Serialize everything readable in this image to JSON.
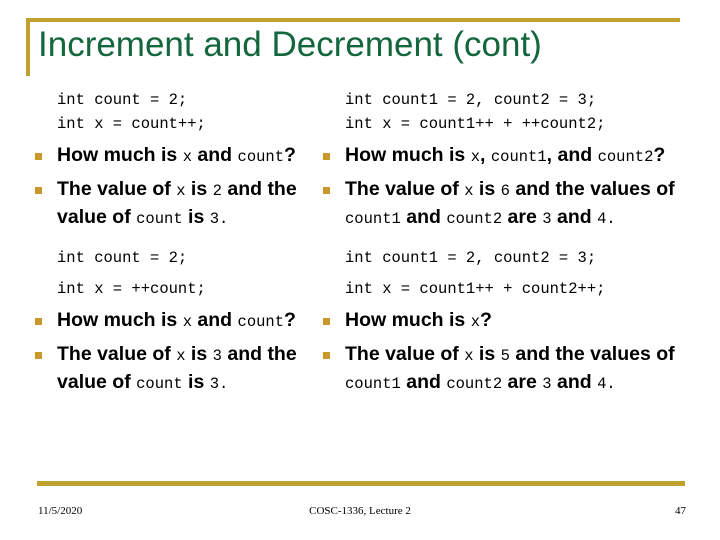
{
  "slide": {
    "title": "Increment and Decrement (cont)",
    "accent_gold": "#BFA22E",
    "bullet_gold": "#C8982A",
    "title_green": "#14663C"
  },
  "left_column": {
    "block1": {
      "code": [
        "int count = 2;",
        "int x = count++;"
      ],
      "bullets": [
        {
          "parts": [
            {
              "text": "How much is ",
              "style": "bold"
            },
            {
              "text": "x",
              "style": "mono"
            },
            {
              "text": " and ",
              "style": "bold"
            },
            {
              "text": "count",
              "style": "mono"
            },
            {
              "text": "?",
              "style": "bold"
            }
          ]
        },
        {
          "parts": [
            {
              "text": "The value of ",
              "style": "bold"
            },
            {
              "text": "x",
              "style": "mono"
            },
            {
              "text": " is ",
              "style": "bold"
            },
            {
              "text": "2",
              "style": "mono"
            },
            {
              "text": " and the value of ",
              "style": "bold"
            },
            {
              "text": "count",
              "style": "mono"
            },
            {
              "text": " is ",
              "style": "bold"
            },
            {
              "text": "3.",
              "style": "mono"
            }
          ]
        }
      ]
    },
    "block2": {
      "code": [
        "int count = 2;",
        "int x = ++count;"
      ],
      "bullets": [
        {
          "parts": [
            {
              "text": "How much is ",
              "style": "bold"
            },
            {
              "text": "x",
              "style": "mono"
            },
            {
              "text": " and ",
              "style": "bold"
            },
            {
              "text": "count",
              "style": "mono"
            },
            {
              "text": "?",
              "style": "bold"
            }
          ]
        },
        {
          "parts": [
            {
              "text": "The value of ",
              "style": "bold"
            },
            {
              "text": "x",
              "style": "mono"
            },
            {
              "text": " is ",
              "style": "bold"
            },
            {
              "text": "3",
              "style": "mono"
            },
            {
              "text": " and the value of ",
              "style": "bold"
            },
            {
              "text": "count",
              "style": "mono"
            },
            {
              "text": " is ",
              "style": "bold"
            },
            {
              "text": "3.",
              "style": "mono"
            }
          ]
        }
      ]
    }
  },
  "right_column": {
    "block1": {
      "code": [
        "int count1 = 2, count2 = 3;",
        "int x = count1++ + ++count2;"
      ],
      "bullets": [
        {
          "parts": [
            {
              "text": "How much is ",
              "style": "bold"
            },
            {
              "text": "x",
              "style": "mono"
            },
            {
              "text": ", ",
              "style": "bold"
            },
            {
              "text": "count1",
              "style": "mono"
            },
            {
              "text": ", and ",
              "style": "bold"
            },
            {
              "text": "count2",
              "style": "mono"
            },
            {
              "text": "?",
              "style": "bold"
            }
          ]
        },
        {
          "parts": [
            {
              "text": "The value of ",
              "style": "bold"
            },
            {
              "text": "x",
              "style": "mono"
            },
            {
              "text": " is ",
              "style": "bold"
            },
            {
              "text": "6",
              "style": "mono"
            },
            {
              "text": " and the values of ",
              "style": "bold"
            },
            {
              "text": "count1",
              "style": "mono"
            },
            {
              "text": " and ",
              "style": "bold"
            },
            {
              "text": "count2",
              "style": "mono"
            },
            {
              "text": " are ",
              "style": "bold"
            },
            {
              "text": "3",
              "style": "mono"
            },
            {
              "text": " and ",
              "style": "bold"
            },
            {
              "text": "4.",
              "style": "mono"
            }
          ]
        }
      ]
    },
    "block2": {
      "code": [
        "int count1 = 2, count2 = 3;",
        "int x = count1++ + count2++;"
      ],
      "bullets": [
        {
          "parts": [
            {
              "text": "How much is ",
              "style": "bold"
            },
            {
              "text": "x",
              "style": "mono"
            },
            {
              "text": "?",
              "style": "bold"
            }
          ]
        },
        {
          "parts": [
            {
              "text": "The value of ",
              "style": "bold"
            },
            {
              "text": "x",
              "style": "mono"
            },
            {
              "text": " is ",
              "style": "bold"
            },
            {
              "text": "5",
              "style": "mono"
            },
            {
              "text": " and the values of ",
              "style": "bold"
            },
            {
              "text": "count1",
              "style": "mono"
            },
            {
              "text": " and ",
              "style": "bold"
            },
            {
              "text": "count2",
              "style": "mono"
            },
            {
              "text": " are ",
              "style": "bold"
            },
            {
              "text": "3",
              "style": "mono"
            },
            {
              "text": " and ",
              "style": "bold"
            },
            {
              "text": "4.",
              "style": "mono"
            }
          ]
        }
      ]
    }
  },
  "footer": {
    "date": "11/5/2020",
    "center": "COSC-1336, Lecture 2",
    "number": "47"
  }
}
